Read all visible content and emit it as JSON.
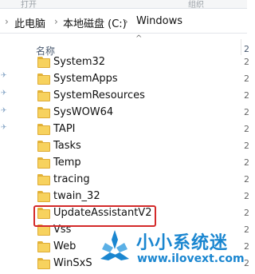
{
  "ribbon": {
    "left_label": "打开",
    "right_label": "组织"
  },
  "breadcrumb": {
    "items": [
      "此电脑",
      "本地磁盘 (C:)",
      "Windows"
    ],
    "separator": "›"
  },
  "columns": {
    "name": "名称",
    "next": "2"
  },
  "files": [
    {
      "name": "System32",
      "date": "2"
    },
    {
      "name": "SystemApps",
      "date": "2"
    },
    {
      "name": "SystemResources",
      "date": "2"
    },
    {
      "name": "SysWOW64",
      "date": "2"
    },
    {
      "name": "TAPI",
      "date": "2"
    },
    {
      "name": "Tasks",
      "date": "2"
    },
    {
      "name": "Temp",
      "date": "2"
    },
    {
      "name": "tracing",
      "date": "2"
    },
    {
      "name": "twain_32",
      "date": "2"
    },
    {
      "name": "UpdateAssistantV2",
      "date": "2"
    },
    {
      "name": "Vss",
      "date": "2"
    },
    {
      "name": "Web",
      "date": "2"
    },
    {
      "name": "WinSxS",
      "date": "2"
    }
  ],
  "highlighted_file": "UpdateAssistantV2",
  "watermark": {
    "title": "小小系统迷",
    "url": "www.ilovext.com"
  },
  "colors": {
    "highlight": "#d42a2a",
    "folder": "#f7d25e",
    "watermark": "#1a86d0"
  }
}
